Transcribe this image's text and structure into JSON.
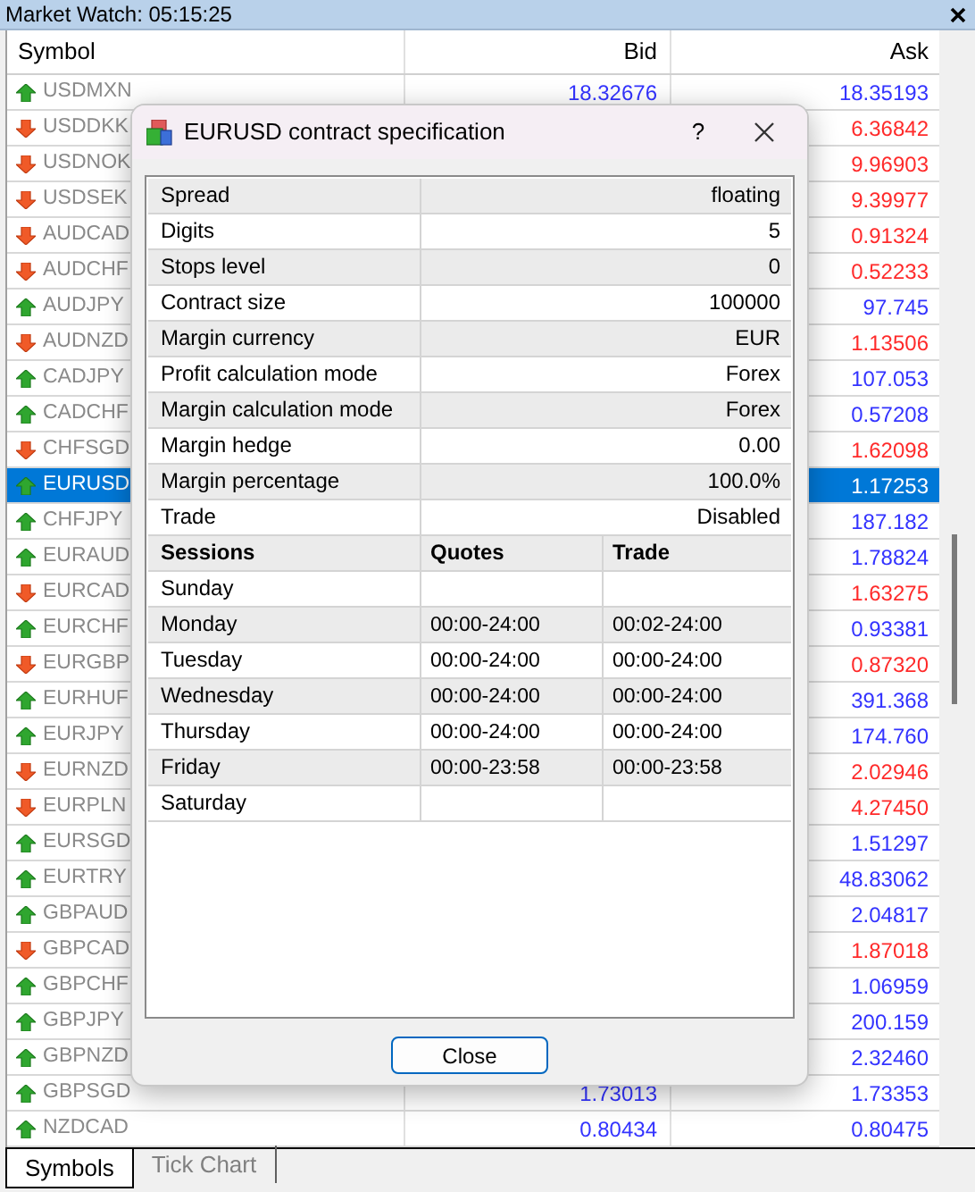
{
  "window": {
    "title": "Market Watch: 05:15:25"
  },
  "table": {
    "columns": [
      "Symbol",
      "Bid",
      "Ask"
    ],
    "rows": [
      {
        "symbol": "USDMXN",
        "kind": "up",
        "bid": "18.32676",
        "ask": "18.35193",
        "selected": false
      },
      {
        "symbol": "USDDKK",
        "kind": "down",
        "ask": "6.36842",
        "selected": false
      },
      {
        "symbol": "USDNOK",
        "kind": "down",
        "ask": "9.96903",
        "selected": false
      },
      {
        "symbol": "USDSEK",
        "kind": "down",
        "ask": "9.39977",
        "selected": false
      },
      {
        "symbol": "AUDCAD",
        "kind": "down",
        "ask": "0.91324",
        "selected": false
      },
      {
        "symbol": "AUDCHF",
        "kind": "down",
        "ask": "0.52233",
        "selected": false
      },
      {
        "symbol": "AUDJPY",
        "kind": "up",
        "ask": "97.745",
        "selected": false
      },
      {
        "symbol": "AUDNZD",
        "kind": "down",
        "ask": "1.13506",
        "selected": false
      },
      {
        "symbol": "CADJPY",
        "kind": "up",
        "ask": "107.053",
        "selected": false
      },
      {
        "symbol": "CADCHF",
        "kind": "up",
        "ask": "0.57208",
        "selected": false
      },
      {
        "symbol": "CHFSGD",
        "kind": "down",
        "ask": "1.62098",
        "selected": false
      },
      {
        "symbol": "EURUSD",
        "kind": "up",
        "ask": "1.17253",
        "selected": true
      },
      {
        "symbol": "CHFJPY",
        "kind": "up",
        "ask": "187.182",
        "selected": false
      },
      {
        "symbol": "EURAUD",
        "kind": "up",
        "ask": "1.78824",
        "selected": false
      },
      {
        "symbol": "EURCAD",
        "kind": "down",
        "ask": "1.63275",
        "selected": false
      },
      {
        "symbol": "EURCHF",
        "kind": "up",
        "ask": "0.93381",
        "selected": false
      },
      {
        "symbol": "EURGBP",
        "kind": "down",
        "ask": "0.87320",
        "selected": false
      },
      {
        "symbol": "EURHUF",
        "kind": "up",
        "ask": "391.368",
        "selected": false
      },
      {
        "symbol": "EURJPY",
        "kind": "up",
        "ask": "174.760",
        "selected": false
      },
      {
        "symbol": "EURNZD",
        "kind": "down",
        "ask": "2.02946",
        "selected": false
      },
      {
        "symbol": "EURPLN",
        "kind": "down",
        "ask": "4.27450",
        "selected": false
      },
      {
        "symbol": "EURSGD",
        "kind": "up",
        "ask": "1.51297",
        "selected": false
      },
      {
        "symbol": "EURTRY",
        "kind": "up",
        "ask": "48.83062",
        "selected": false
      },
      {
        "symbol": "GBPAUD",
        "kind": "up",
        "ask": "2.04817",
        "selected": false
      },
      {
        "symbol": "GBPCAD",
        "kind": "down",
        "ask": "1.87018",
        "selected": false
      },
      {
        "symbol": "GBPCHF",
        "kind": "up",
        "ask": "1.06959",
        "selected": false
      },
      {
        "symbol": "GBPJPY",
        "kind": "up",
        "ask": "200.159",
        "selected": false
      },
      {
        "symbol": "GBPNZD",
        "kind": "up",
        "ask": "2.32460",
        "selected": false
      },
      {
        "symbol": "GBPSGD",
        "kind": "up",
        "bid": "1.73013",
        "ask": "1.73353",
        "selected": false
      },
      {
        "symbol": "NZDCAD",
        "kind": "up",
        "bid": "0.80434",
        "ask": "0.80475",
        "selected": false
      }
    ]
  },
  "tabs": [
    {
      "label": "Symbols",
      "selected": true
    },
    {
      "label": "Tick Chart",
      "selected": false
    }
  ],
  "dialog": {
    "title": "EURUSD contract specification",
    "help": "?",
    "properties": [
      {
        "label": "Spread",
        "value": "floating"
      },
      {
        "label": "Digits",
        "value": "5"
      },
      {
        "label": "Stops level",
        "value": "0"
      },
      {
        "label": "Contract size",
        "value": "100000"
      },
      {
        "label": "Margin currency",
        "value": "EUR"
      },
      {
        "label": "Profit calculation mode",
        "value": "Forex"
      },
      {
        "label": "Margin calculation mode",
        "value": "Forex"
      },
      {
        "label": "Margin hedge",
        "value": "0.00"
      },
      {
        "label": "Margin percentage",
        "value": "100.0%"
      },
      {
        "label": "Trade",
        "value": "Disabled"
      }
    ],
    "sessions": {
      "columns": [
        "Sessions",
        "Quotes",
        "Trade"
      ],
      "rows": [
        {
          "day": "Sunday"
        },
        {
          "day": "Monday",
          "quotes": "00:00-24:00",
          "trade": "00:02-24:00"
        },
        {
          "day": "Tuesday",
          "quotes": "00:00-24:00",
          "trade": "00:00-24:00"
        },
        {
          "day": "Wednesday",
          "quotes": "00:00-24:00",
          "trade": "00:00-24:00"
        },
        {
          "day": "Thursday",
          "quotes": "00:00-24:00",
          "trade": "00:00-24:00"
        },
        {
          "day": "Friday",
          "quotes": "00:00-23:58",
          "trade": "00:00-23:58"
        },
        {
          "day": "Saturday"
        }
      ]
    },
    "buttons": [
      "Close"
    ]
  }
}
